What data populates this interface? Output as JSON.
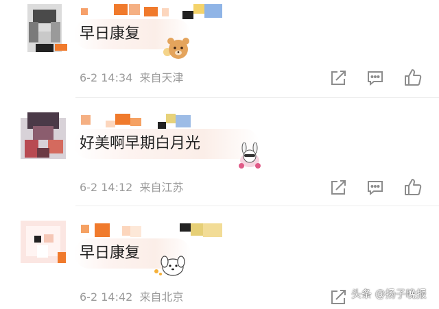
{
  "comments": [
    {
      "text": "早日康复",
      "time": "6-2 14:34",
      "location": "来自天津"
    },
    {
      "text": "好美啊早期白月光",
      "time": "6-2 14:12",
      "location": "来自江苏"
    },
    {
      "text": "早日康复",
      "time": "6-2 14:42",
      "location": "来自北京"
    }
  ],
  "icons": {
    "share": "share-icon",
    "reply": "comment-icon",
    "like": "thumbs-up-icon"
  },
  "watermark": "头条 @扬子晚报",
  "colors": {
    "meta_text": "#9a9a9a",
    "icon": "#8c8c8c",
    "mosaic_orange": "#f07a2c"
  }
}
